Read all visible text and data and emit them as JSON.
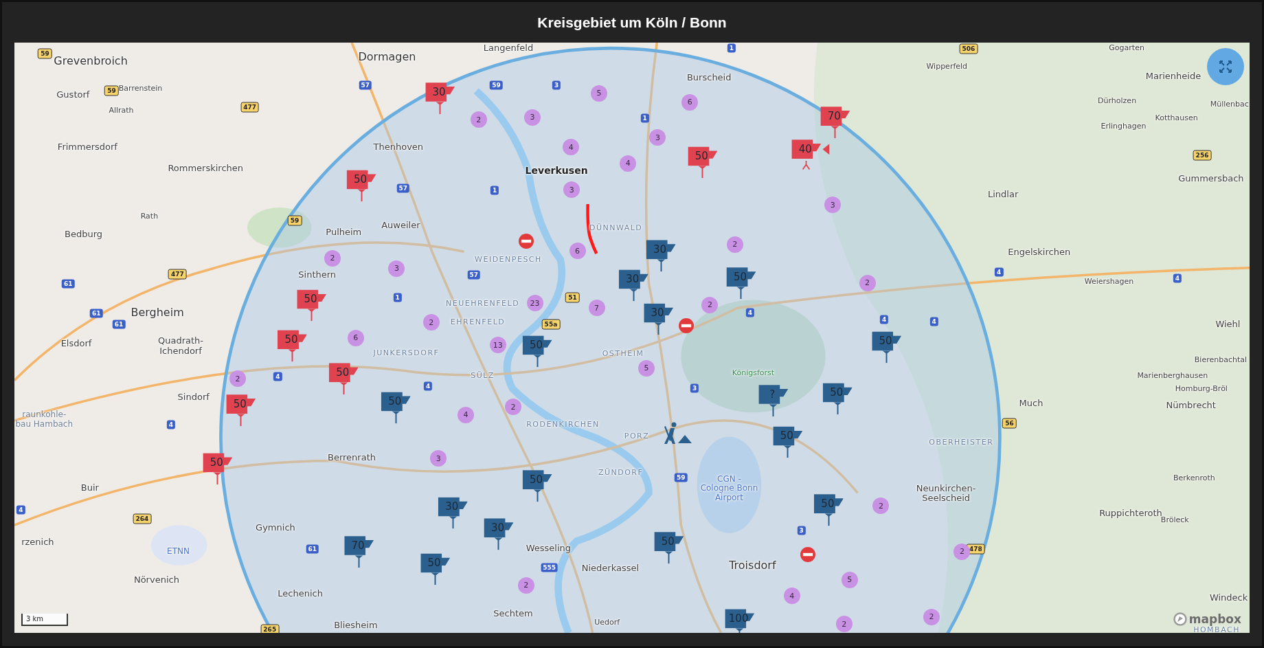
{
  "header": {
    "title": "Kreisgebiet um Köln / Bonn"
  },
  "map": {
    "place_labels": [
      {
        "text": "Grevenbroich",
        "kind": "city"
      },
      {
        "text": "Dormagen",
        "kind": "city"
      },
      {
        "text": "Langenfeld",
        "kind": "town"
      },
      {
        "text": "Burscheid",
        "kind": "town"
      },
      {
        "text": "Wipperfeld",
        "kind": "village"
      },
      {
        "text": "Gogarten",
        "kind": "village"
      },
      {
        "text": "Marienheide",
        "kind": "town"
      },
      {
        "text": "Gustorf",
        "kind": "town"
      },
      {
        "text": "Barrenstein",
        "kind": "village"
      },
      {
        "text": "Allrath",
        "kind": "village"
      },
      {
        "text": "Frimmersdorf",
        "kind": "town"
      },
      {
        "text": "Rommerskirchen",
        "kind": "town"
      },
      {
        "text": "Thenhoven",
        "kind": "town"
      },
      {
        "text": "Leverkusen",
        "kind": "major"
      },
      {
        "text": "Dürholzen",
        "kind": "village"
      },
      {
        "text": "Kotthausen",
        "kind": "village"
      },
      {
        "text": "Erlinghagen",
        "kind": "village"
      },
      {
        "text": "Müllenbac",
        "kind": "village"
      },
      {
        "text": "Lindlar",
        "kind": "town"
      },
      {
        "text": "Gummersbach",
        "kind": "town"
      },
      {
        "text": "Rath",
        "kind": "village"
      },
      {
        "text": "Bedburg",
        "kind": "town"
      },
      {
        "text": "Pulheim",
        "kind": "town"
      },
      {
        "text": "Auweiler",
        "kind": "town"
      },
      {
        "text": "DÜNNWALD",
        "kind": "district"
      },
      {
        "text": "WEIDENPESCH",
        "kind": "district"
      },
      {
        "text": "Sinthern",
        "kind": "town"
      },
      {
        "text": "Engelskirchen",
        "kind": "town"
      },
      {
        "text": "Weiershagen",
        "kind": "village"
      },
      {
        "text": "NEUEHRENFELD",
        "kind": "district"
      },
      {
        "text": "EHRENFELD",
        "kind": "district"
      },
      {
        "text": "Bergheim",
        "kind": "city"
      },
      {
        "text": "Elsdorf",
        "kind": "town"
      },
      {
        "text": "Quadrath-Ichendorf",
        "kind": "town"
      },
      {
        "text": "JUNKERSDORF",
        "kind": "district"
      },
      {
        "text": "SÜLZ",
        "kind": "district"
      },
      {
        "text": "OSTHEIM",
        "kind": "district"
      },
      {
        "text": "Königsforst",
        "kind": "park"
      },
      {
        "text": "Wiehl",
        "kind": "town"
      },
      {
        "text": "Bierenbachtal",
        "kind": "village"
      },
      {
        "text": "Marienberghausen",
        "kind": "village"
      },
      {
        "text": "Homburg-Bröl",
        "kind": "village"
      },
      {
        "text": "Nümbrecht",
        "kind": "town"
      },
      {
        "text": "Sindorf",
        "kind": "town"
      },
      {
        "text": "Much",
        "kind": "town"
      },
      {
        "text": "RODENKIRCHEN",
        "kind": "district"
      },
      {
        "text": "PORZ",
        "kind": "district"
      },
      {
        "text": "OBERHEISTER",
        "kind": "district"
      },
      {
        "text": "raunkohle-bau Hambach",
        "kind": "feature"
      },
      {
        "text": "Berrenrath",
        "kind": "town"
      },
      {
        "text": "ZÜNDORF",
        "kind": "district"
      },
      {
        "text": "Buir",
        "kind": "town"
      },
      {
        "text": "CGN - Cologne Bonn Airport",
        "kind": "airport"
      },
      {
        "text": "Neunkirchen-Seelscheid",
        "kind": "town"
      },
      {
        "text": "Berkenroth",
        "kind": "village"
      },
      {
        "text": "Ruppichteroth",
        "kind": "town"
      },
      {
        "text": "Gymnich",
        "kind": "town"
      },
      {
        "text": "Bröleck",
        "kind": "village"
      },
      {
        "text": "ETNN",
        "kind": "airport"
      },
      {
        "text": "rzenich",
        "kind": "town"
      },
      {
        "text": "Wesseling",
        "kind": "town"
      },
      {
        "text": "Niederkassel",
        "kind": "town"
      },
      {
        "text": "Troisdorf",
        "kind": "city"
      },
      {
        "text": "Nörvenich",
        "kind": "town"
      },
      {
        "text": "Lechenich",
        "kind": "town"
      },
      {
        "text": "Sechtem",
        "kind": "town"
      },
      {
        "text": "Uedorf",
        "kind": "village"
      },
      {
        "text": "Bliesheim",
        "kind": "town"
      },
      {
        "text": "Windeck",
        "kind": "town"
      },
      {
        "text": "HOMBACH",
        "kind": "district"
      }
    ],
    "road_shields": [
      {
        "text": "59",
        "kind": "federal"
      },
      {
        "text": "59",
        "kind": "federal"
      },
      {
        "text": "477",
        "kind": "federal"
      },
      {
        "text": "57",
        "kind": "motorway"
      },
      {
        "text": "59",
        "kind": "motorway"
      },
      {
        "text": "3",
        "kind": "motorway"
      },
      {
        "text": "1",
        "kind": "motorway"
      },
      {
        "text": "506",
        "kind": "federal"
      },
      {
        "text": "1",
        "kind": "motorway"
      },
      {
        "text": "57",
        "kind": "motorway"
      },
      {
        "text": "1",
        "kind": "motorway"
      },
      {
        "text": "59",
        "kind": "federal"
      },
      {
        "text": "477",
        "kind": "federal"
      },
      {
        "text": "61",
        "kind": "motorway"
      },
      {
        "text": "61",
        "kind": "motorway"
      },
      {
        "text": "61",
        "kind": "motorway"
      },
      {
        "text": "57",
        "kind": "motorway"
      },
      {
        "text": "1",
        "kind": "motorway"
      },
      {
        "text": "51",
        "kind": "federal"
      },
      {
        "text": "55a",
        "kind": "federal"
      },
      {
        "text": "4",
        "kind": "motorway"
      },
      {
        "text": "4",
        "kind": "motorway"
      },
      {
        "text": "4",
        "kind": "motorway"
      },
      {
        "text": "4",
        "kind": "motorway"
      },
      {
        "text": "4",
        "kind": "motorway"
      },
      {
        "text": "4",
        "kind": "motorway"
      },
      {
        "text": "4",
        "kind": "motorway"
      },
      {
        "text": "3",
        "kind": "motorway"
      },
      {
        "text": "4",
        "kind": "motorway"
      },
      {
        "text": "256",
        "kind": "federal"
      },
      {
        "text": "56",
        "kind": "federal"
      },
      {
        "text": "59",
        "kind": "motorway"
      },
      {
        "text": "3",
        "kind": "motorway"
      },
      {
        "text": "478",
        "kind": "federal"
      },
      {
        "text": "264",
        "kind": "federal"
      },
      {
        "text": "61",
        "kind": "motorway"
      },
      {
        "text": "555",
        "kind": "motorway"
      },
      {
        "text": "4",
        "kind": "motorway"
      },
      {
        "text": "265",
        "kind": "federal"
      }
    ],
    "markers": [
      {
        "kind": "speed",
        "value": "30",
        "color": "#e0434f"
      },
      {
        "kind": "speed",
        "value": "50",
        "color": "#e0434f"
      },
      {
        "kind": "speed",
        "value": "50",
        "color": "#e0434f"
      },
      {
        "kind": "speed",
        "value": "50",
        "color": "#e0434f"
      },
      {
        "kind": "speed",
        "value": "50",
        "color": "#e0434f"
      },
      {
        "kind": "speed",
        "value": "50",
        "color": "#e0434f"
      },
      {
        "kind": "speed",
        "value": "50",
        "color": "#e0434f"
      },
      {
        "kind": "speed",
        "value": "50",
        "color": "#e0434f"
      },
      {
        "kind": "speed",
        "value": "70",
        "color": "#e0434f"
      },
      {
        "kind": "mobile",
        "value": "40",
        "color": "#e0434f"
      },
      {
        "kind": "speed",
        "value": "30",
        "color": "#2b5f8e"
      },
      {
        "kind": "speed",
        "value": "30",
        "color": "#2b5f8e"
      },
      {
        "kind": "speed",
        "value": "50",
        "color": "#2b5f8e"
      },
      {
        "kind": "speed",
        "value": "30",
        "color": "#2b5f8e"
      },
      {
        "kind": "speed",
        "value": "50",
        "color": "#2b5f8e"
      },
      {
        "kind": "speed",
        "value": "50",
        "color": "#2b5f8e"
      },
      {
        "kind": "speed",
        "value": "50",
        "color": "#2b5f8e"
      },
      {
        "kind": "speed",
        "value": "?",
        "color": "#2b5f8e"
      },
      {
        "kind": "speed",
        "value": "50",
        "color": "#2b5f8e"
      },
      {
        "kind": "speed",
        "value": "50",
        "color": "#2b5f8e"
      },
      {
        "kind": "speed",
        "value": "50",
        "color": "#2b5f8e"
      },
      {
        "kind": "speed",
        "value": "30",
        "color": "#2b5f8e"
      },
      {
        "kind": "speed",
        "value": "30",
        "color": "#2b5f8e"
      },
      {
        "kind": "speed",
        "value": "50",
        "color": "#2b5f8e"
      },
      {
        "kind": "speed",
        "value": "70",
        "color": "#2b5f8e"
      },
      {
        "kind": "speed",
        "value": "50",
        "color": "#2b5f8e"
      },
      {
        "kind": "speed",
        "value": "50",
        "color": "#2b5f8e"
      },
      {
        "kind": "speed",
        "value": "100",
        "color": "#2b5f8e"
      },
      {
        "kind": "cluster",
        "value": "2"
      },
      {
        "kind": "cluster",
        "value": "3"
      },
      {
        "kind": "cluster",
        "value": "5"
      },
      {
        "kind": "cluster",
        "value": "6"
      },
      {
        "kind": "cluster",
        "value": "3"
      },
      {
        "kind": "cluster",
        "value": "4"
      },
      {
        "kind": "cluster",
        "value": "4"
      },
      {
        "kind": "cluster",
        "value": "3"
      },
      {
        "kind": "cluster",
        "value": "3"
      },
      {
        "kind": "cluster",
        "value": "2"
      },
      {
        "kind": "cluster",
        "value": "6"
      },
      {
        "kind": "cluster",
        "value": "2"
      },
      {
        "kind": "cluster",
        "value": "3"
      },
      {
        "kind": "cluster",
        "value": "2"
      },
      {
        "kind": "cluster",
        "value": "23"
      },
      {
        "kind": "cluster",
        "value": "7"
      },
      {
        "kind": "cluster",
        "value": "2"
      },
      {
        "kind": "cluster",
        "value": "2"
      },
      {
        "kind": "cluster",
        "value": "6"
      },
      {
        "kind": "cluster",
        "value": "13"
      },
      {
        "kind": "cluster",
        "value": "5"
      },
      {
        "kind": "cluster",
        "value": "2"
      },
      {
        "kind": "cluster",
        "value": "2"
      },
      {
        "kind": "cluster",
        "value": "4"
      },
      {
        "kind": "cluster",
        "value": "3"
      },
      {
        "kind": "cluster",
        "value": "2"
      },
      {
        "kind": "cluster",
        "value": "2"
      },
      {
        "kind": "cluster",
        "value": "2"
      },
      {
        "kind": "cluster",
        "value": "4"
      },
      {
        "kind": "cluster",
        "value": "5"
      },
      {
        "kind": "cluster",
        "value": "2"
      },
      {
        "kind": "cluster",
        "value": "2"
      },
      {
        "kind": "closure"
      },
      {
        "kind": "closure"
      },
      {
        "kind": "closure"
      },
      {
        "kind": "construction"
      }
    ],
    "scale": "3 km",
    "attribution": "mapbox"
  }
}
